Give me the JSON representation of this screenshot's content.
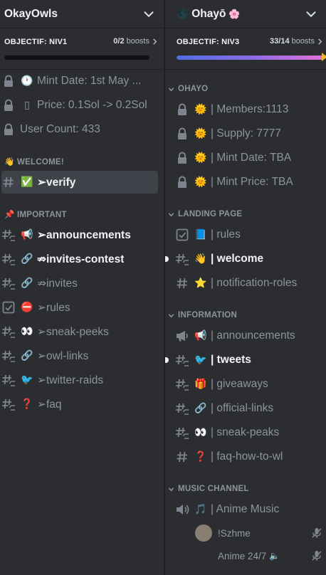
{
  "left": {
    "server_name": "OkayOwls",
    "boost": {
      "label": "OBJECTIF: NIV1",
      "count_bold": "0/2",
      "count_rest": " boosts",
      "progress": 0.0
    },
    "channels": [
      {
        "kind": "lock",
        "emoji": "🕐",
        "text": "Mint Date: 1st May ...",
        "style": "normal"
      },
      {
        "kind": "lock",
        "emoji": "▯",
        "text": "Price: 0.1Sol -> 0.2Sol",
        "style": "normal"
      },
      {
        "kind": "lock",
        "emoji": "",
        "text": "User Count: 433",
        "style": "normal"
      }
    ],
    "category_welcome": "👋 WELCOME!",
    "verify": {
      "kind": "hash",
      "emoji": "✅",
      "text": "➢verify",
      "style": "selected"
    },
    "category_important": "📌 IMPORTANT",
    "important": [
      {
        "kind": "hashthread",
        "emoji": "📢",
        "text": "➢announcements",
        "style": "bold"
      },
      {
        "kind": "hashthread",
        "emoji": "🔗",
        "text": "⇏invites-contest",
        "style": "bold"
      },
      {
        "kind": "hashthread",
        "emoji": "🔗",
        "text": "⇏invites",
        "style": "normal"
      },
      {
        "kind": "rules",
        "emoji": "⛔",
        "text": "➢rules",
        "style": "normal"
      },
      {
        "kind": "hashthread",
        "emoji": "👀",
        "text": "➢sneak-peeks",
        "style": "normal"
      },
      {
        "kind": "hashthread",
        "emoji": "🔗",
        "text": "➢owl-links",
        "style": "normal"
      },
      {
        "kind": "hashthread",
        "emoji": "🐦",
        "text": "➢twitter-raids",
        "style": "normal"
      },
      {
        "kind": "hashthread",
        "emoji": "❓",
        "text": "➢faq",
        "style": "normal"
      }
    ]
  },
  "right": {
    "server_icon": "🌑",
    "server_name": "Ohayō",
    "server_emoji": "🌸",
    "boost": {
      "label": "OBJECTIF: NIV3",
      "count_bold": "33/14",
      "count_rest": " boosts",
      "progress": 0.99
    },
    "category_ohayo": "OHAYO",
    "ohayo": [
      {
        "kind": "lock",
        "emoji": "🌞",
        "text": "| Members:1113"
      },
      {
        "kind": "lock",
        "emoji": "🌞",
        "text": "| Supply: 7777"
      },
      {
        "kind": "lock",
        "emoji": "🌞",
        "text": "| Mint Date: TBA"
      },
      {
        "kind": "lock",
        "emoji": "🌞",
        "text": "| Mint Price: TBA"
      }
    ],
    "category_landing": "LANDING PAGE",
    "landing": [
      {
        "kind": "rules",
        "emoji": "📘",
        "text": "| rules",
        "style": "normal"
      },
      {
        "kind": "hashthread",
        "emoji": "👋",
        "text": "| welcome",
        "style": "bold",
        "unread": true
      },
      {
        "kind": "hash",
        "emoji": "⭐",
        "text": "| notification-roles",
        "style": "normal"
      }
    ],
    "category_information": "INFORMATION",
    "information": [
      {
        "kind": "announce",
        "emoji": "📢",
        "text": "| announcements",
        "style": "normal"
      },
      {
        "kind": "hashthread",
        "emoji": "🐦",
        "text": "| tweets",
        "style": "bold",
        "unread": true
      },
      {
        "kind": "hashthread",
        "emoji": "🎁",
        "text": "| giveaways",
        "style": "normal"
      },
      {
        "kind": "hashthread",
        "emoji": "🔗",
        "text": "| official-links",
        "style": "normal"
      },
      {
        "kind": "hashthread",
        "emoji": "👀",
        "text": "| sneak-peaks",
        "style": "normal"
      },
      {
        "kind": "hash",
        "emoji": "❓",
        "text": "| faq-how-to-wl",
        "style": "normal"
      }
    ],
    "category_music": "MUSIC CHANNEL",
    "music_channel": {
      "kind": "stage",
      "emoji": "🎵",
      "text": "| Anime Music"
    },
    "voice_users": [
      {
        "name": "!Szhme",
        "avatar_color": "#8a7f73"
      },
      {
        "name": "Anime 24/7",
        "avatar_color": "#2c2d33",
        "speaker": "🔈"
      }
    ]
  },
  "colors": {
    "bg": "#2b2d31",
    "selected": "#404249",
    "text_muted": "#8e949c",
    "text_bright": "#f2f3f5",
    "boost_gradient_start": "#4f6fe0",
    "boost_gradient_end": "#e173d6"
  }
}
